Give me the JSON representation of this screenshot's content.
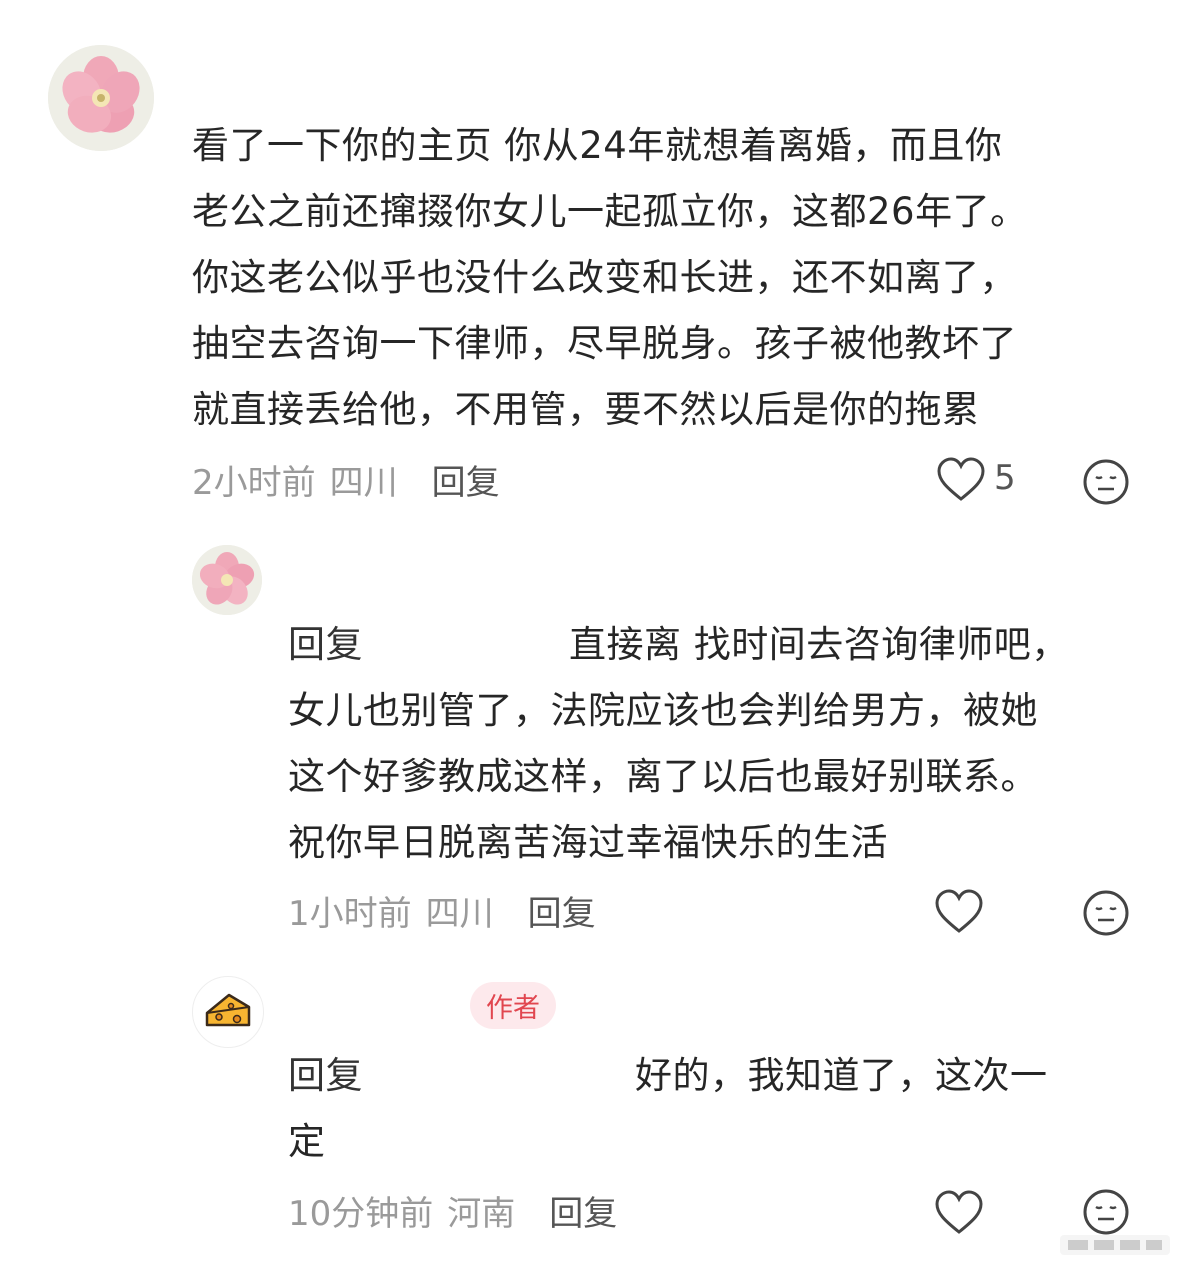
{
  "comments": [
    {
      "body": "看了一下你的主页 你从24年就想着离婚，而且你老公之前还撺掇你女儿一起孤立你，这都26年了。你这老公似乎也没什么改变和长进，还不如离了，抽空去咨询一下律师，尽早脱身。孩子被他教坏了就直接丢给他，不用管，要不然以后是你的拖累",
      "lines": [
        "看了一下你的主页 你从24年就想着离婚，而且你",
        "老公之前还撺掇你女儿一起孤立你，这都26年了。",
        "你这老公似乎也没什么改变和长进，还不如离了，",
        "抽空去咨询一下律师，尽早脱身。孩子被他教坏了",
        "就直接丢给他，不用管，要不然以后是你的拖累"
      ],
      "time": "2小时前",
      "location": "四川",
      "reply_label": "回复",
      "likes": "5"
    },
    {
      "reply_prefix": "回复",
      "lines": [
        "直接离 找时间去咨询律师吧，",
        "女儿也别管了，法院应该也会判给男方，被她",
        "这个好爹教成这样，离了以后也最好别联系。",
        "祝你早日脱离苦海过幸福快乐的生活"
      ],
      "time": "1小时前",
      "location": "四川",
      "reply_label": "回复"
    },
    {
      "author_badge": "作者",
      "reply_prefix": "回复",
      "lines": [
        "好的，我知道了，这次一",
        "定"
      ],
      "time": "10分钟前",
      "location": "河南",
      "reply_label": "回复"
    }
  ],
  "colors": {
    "text": "#262626",
    "meta": "#9a9a9a",
    "badge_bg": "#fde9ec",
    "badge_text": "#e1464f"
  },
  "icons": [
    "flower-avatar",
    "cheese-avatar",
    "heart-icon",
    "neutral-face-icon"
  ]
}
